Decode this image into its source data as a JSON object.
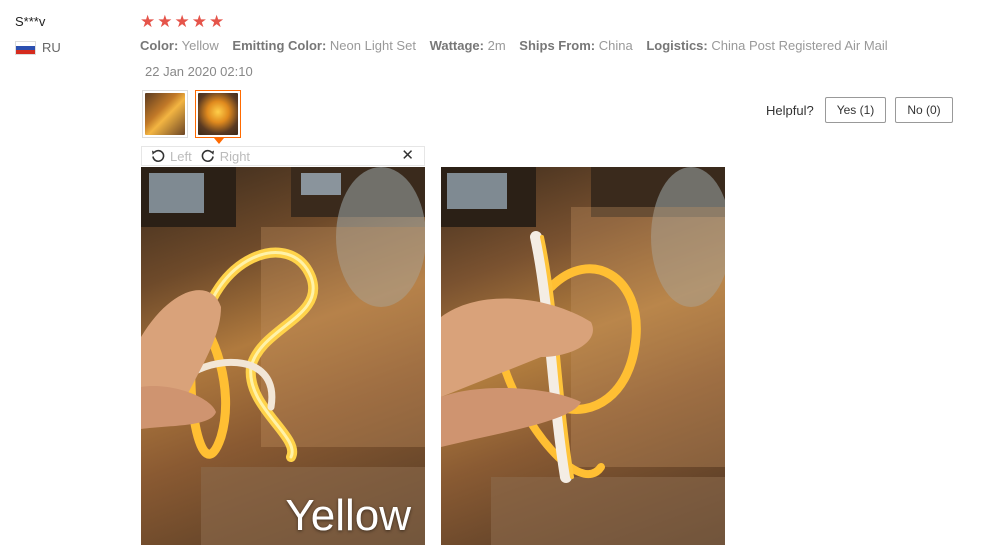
{
  "review": {
    "user": "S***v",
    "country_code": "RU",
    "rating": 5,
    "stars": [
      "★",
      "★",
      "★",
      "★",
      "★"
    ],
    "properties": [
      {
        "key": "Color:",
        "value": "Yellow"
      },
      {
        "key": "Emitting Color:",
        "value": "Neon Light Set"
      },
      {
        "key": "Wattage:",
        "value": "2m"
      },
      {
        "key": "Ships From:",
        "value": "China"
      },
      {
        "key": "Logistics:",
        "value": "China Post Registered Air Mail"
      }
    ],
    "date": "22 Jan 2020 02:10"
  },
  "helpful": {
    "label": "Helpful?",
    "yes_label": "Yes (1)",
    "no_label": "No (0)"
  },
  "viewer": {
    "rotate_left_label": "Left",
    "rotate_right_label": "Right",
    "close_glyph": "✕",
    "photo_caption": "Yellow"
  },
  "colors": {
    "star": "#e5544a",
    "accent": "#ff6a00",
    "neon": "#ffb21e"
  },
  "icons": {
    "rotate_left": "rotate-left-icon",
    "rotate_right": "rotate-right-icon",
    "close": "close-icon",
    "flag": "russia-flag-icon"
  }
}
